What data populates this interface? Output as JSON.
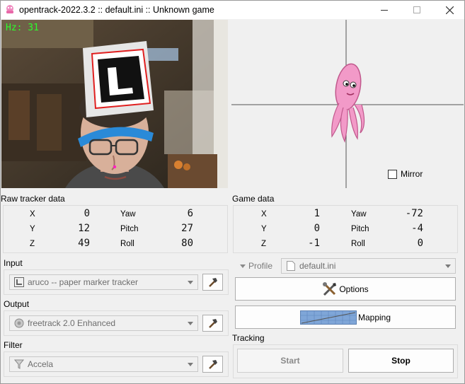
{
  "window": {
    "title": "opentrack-2022.3.2 :: default.ini :: Unknown game",
    "minimize_icon": "minimize-icon",
    "maximize_icon": "maximize-icon",
    "close_icon": "close-icon"
  },
  "camera": {
    "hz_text": "Hz: 31"
  },
  "pose_view": {
    "mirror_label": "Mirror",
    "mirror_checked": false
  },
  "raw_tracker": {
    "title": "Raw tracker data",
    "labels": {
      "x": "X",
      "y": "Y",
      "z": "Z",
      "yaw": "Yaw",
      "pitch": "Pitch",
      "roll": "Roll"
    },
    "values": {
      "x": "0",
      "y": "12",
      "z": "49",
      "yaw": "6",
      "pitch": "27",
      "roll": "80"
    }
  },
  "game_data": {
    "title": "Game data",
    "labels": {
      "x": "X",
      "y": "Y",
      "z": "Z",
      "yaw": "Yaw",
      "pitch": "Pitch",
      "roll": "Roll"
    },
    "values": {
      "x": "1",
      "y": "0",
      "z": "-1",
      "yaw": "-72",
      "pitch": "-4",
      "roll": "0"
    }
  },
  "input": {
    "title": "Input",
    "selected": "aruco -- paper marker tracker",
    "icon": "aruco-icon"
  },
  "output": {
    "title": "Output",
    "selected": "freetrack 2.0 Enhanced",
    "icon": "freetrack-icon"
  },
  "filter": {
    "title": "Filter",
    "selected": "Accela",
    "icon": "filter-icon"
  },
  "profile": {
    "label": "Profile",
    "selected": "default.ini"
  },
  "buttons": {
    "options": "Options",
    "mapping": "Mapping",
    "start": "Start",
    "stop": "Stop"
  },
  "tracking": {
    "title": "Tracking"
  }
}
